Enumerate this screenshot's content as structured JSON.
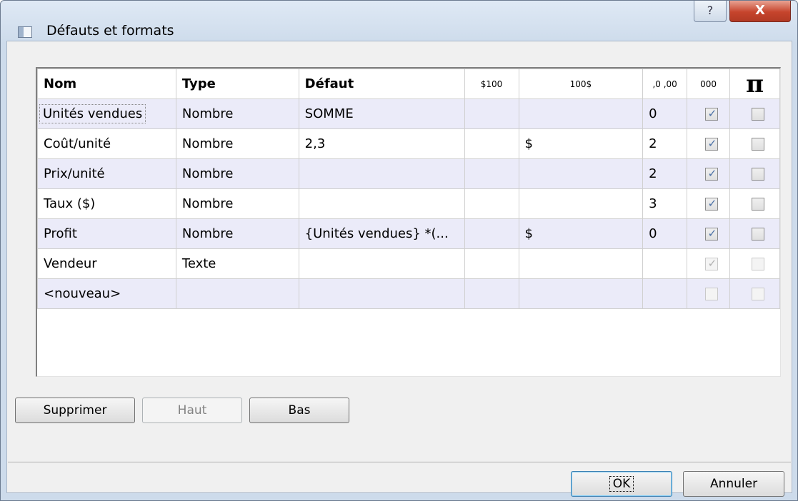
{
  "window": {
    "title": "Défauts et formats",
    "help_glyph": "?",
    "close_glyph": "X"
  },
  "grid": {
    "headers": {
      "nom": "Nom",
      "type": "Type",
      "defaut": "Défaut",
      "prefix_currency": "$100",
      "suffix_currency": "100$",
      "decimals": ",0 ,00",
      "thousands": "000",
      "pi": "π"
    },
    "rows": [
      {
        "nom": "Unités vendues",
        "type": "Nombre",
        "defaut": "SOMME",
        "prefix": "",
        "suffix": "",
        "decimals": "0",
        "thousands": true,
        "pi": false,
        "enabled": true
      },
      {
        "nom": "Coût/unité",
        "type": "Nombre",
        "defaut": "2,3",
        "prefix": "",
        "suffix": "$",
        "decimals": "2",
        "thousands": true,
        "pi": false,
        "enabled": true
      },
      {
        "nom": "Prix/unité",
        "type": "Nombre",
        "defaut": "",
        "prefix": "",
        "suffix": "",
        "decimals": "2",
        "thousands": true,
        "pi": false,
        "enabled": true
      },
      {
        "nom": "Taux ($)",
        "type": "Nombre",
        "defaut": "",
        "prefix": "",
        "suffix": "",
        "decimals": "3",
        "thousands": true,
        "pi": false,
        "enabled": true
      },
      {
        "nom": "Profit",
        "type": "Nombre",
        "defaut": "{Unités vendues} *(...",
        "prefix": "",
        "suffix": "$",
        "decimals": "0",
        "thousands": true,
        "pi": false,
        "enabled": true
      },
      {
        "nom": "Vendeur",
        "type": "Texte",
        "defaut": "",
        "prefix": "",
        "suffix": "",
        "decimals": "",
        "thousands": true,
        "pi": false,
        "enabled": false
      },
      {
        "nom": "<nouveau>",
        "type": "",
        "defaut": "",
        "prefix": "",
        "suffix": "",
        "decimals": "",
        "thousands": false,
        "pi": false,
        "enabled": false
      }
    ]
  },
  "buttons": {
    "delete": "Supprimer",
    "up": "Haut",
    "down": "Bas",
    "ok": "OK",
    "cancel": "Annuler"
  }
}
